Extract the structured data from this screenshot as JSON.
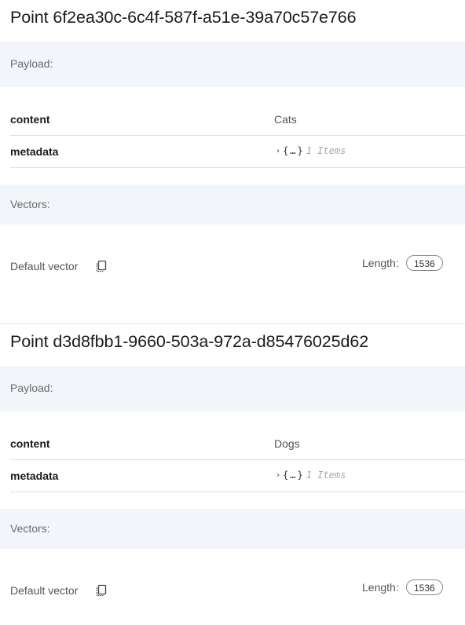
{
  "points": [
    {
      "title": "Point 6f2ea30c-6c4f-587f-a51e-39a70c57e766",
      "payload_label": "Payload:",
      "payload": {
        "content_key": "content",
        "content_value": "Cats",
        "metadata_key": "metadata",
        "metadata_caret": "›",
        "metadata_open": "{",
        "metadata_ellipsis": "…",
        "metadata_close": "}",
        "metadata_count": "1 Items"
      },
      "vectors_label": "Vectors:",
      "vector": {
        "name": "Default vector",
        "length_label": "Length:",
        "length_value": "1536"
      }
    },
    {
      "title": "Point d3d8fbb1-9660-503a-972a-d85476025d62",
      "payload_label": "Payload:",
      "payload": {
        "content_key": "content",
        "content_value": "Dogs",
        "metadata_key": "metadata",
        "metadata_caret": "›",
        "metadata_open": "{",
        "metadata_ellipsis": "…",
        "metadata_close": "}",
        "metadata_count": "1 Items"
      },
      "vectors_label": "Vectors:",
      "vector": {
        "name": "Default vector",
        "length_label": "Length:",
        "length_value": "1536"
      }
    }
  ],
  "icons": {
    "copy": "copy-icon"
  },
  "colors": {
    "section_band": "#f2f6fa",
    "divider": "#e0e0e0",
    "muted_text": "#6b6b6b",
    "items_count": "#a8a8a8"
  }
}
